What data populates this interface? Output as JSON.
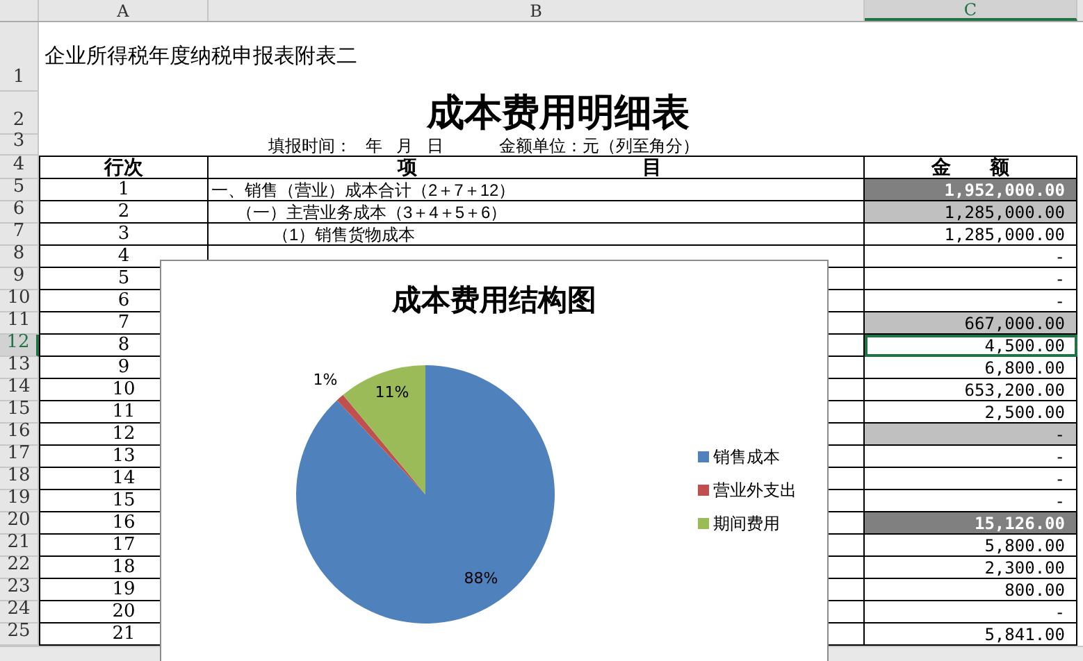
{
  "column_headers": [
    {
      "label": "A",
      "selected": false
    },
    {
      "label": "B",
      "selected": false
    },
    {
      "label": "C",
      "selected": true
    }
  ],
  "form_code": {
    "row_number": "1",
    "text": "企业所得税年度纳税申报表附表二"
  },
  "title": {
    "row_number": "2",
    "text": "成本费用明细表"
  },
  "meta": {
    "row_number": "3",
    "fill_date": "填报时间：   年   月   日",
    "unit": "金额单位：元（列至角分）"
  },
  "header": {
    "row_number": "4",
    "line": "行次",
    "item_left": "项",
    "item_right": "目",
    "amount": "金　　额"
  },
  "rows": [
    {
      "row_number": "5",
      "line": "1",
      "item": "一、销售（营业）成本合计（2＋7＋12）",
      "kind": "section",
      "amount": "1,952,000.00",
      "color": "#808080",
      "selected": false
    },
    {
      "row_number": "6",
      "line": "2",
      "item": "（一）主营业务成本（3＋4＋5＋6）",
      "kind": "group",
      "amount": "1,285,000.00",
      "color": "#c0c0c0",
      "selected": false
    },
    {
      "row_number": "7",
      "line": "3",
      "item": "（1）销售货物成本",
      "kind": "detail",
      "amount": "1,285,000.00",
      "selected": false
    },
    {
      "row_number": "8",
      "line": "4",
      "amount": "-",
      "selected": false
    },
    {
      "row_number": "9",
      "line": "5",
      "amount": "-",
      "selected": false
    },
    {
      "row_number": "10",
      "line": "6",
      "amount": "-",
      "selected": false
    },
    {
      "row_number": "11",
      "line": "7",
      "amount": "667,000.00",
      "color": "#c0c0c0",
      "selected": false
    },
    {
      "row_number": "12",
      "line": "8",
      "amount": "4,500.00",
      "selected": true
    },
    {
      "row_number": "13",
      "line": "9",
      "amount": "6,800.00",
      "selected": false
    },
    {
      "row_number": "14",
      "line": "10",
      "amount": "653,200.00",
      "selected": false
    },
    {
      "row_number": "15",
      "line": "11",
      "amount": "2,500.00",
      "selected": false
    },
    {
      "row_number": "16",
      "line": "12",
      "amount": "-",
      "color": "#c0c0c0",
      "selected": false
    },
    {
      "row_number": "17",
      "line": "13",
      "amount": "-",
      "selected": false
    },
    {
      "row_number": "18",
      "line": "14",
      "amount": "-",
      "selected": false
    },
    {
      "row_number": "19",
      "line": "15",
      "amount": "-",
      "selected": false
    },
    {
      "row_number": "20",
      "line": "16",
      "amount": "15,126.00",
      "color": "#808080",
      "selected": false
    },
    {
      "row_number": "21",
      "line": "17",
      "amount": "5,800.00",
      "selected": false
    },
    {
      "row_number": "22",
      "line": "18",
      "amount": "2,300.00",
      "selected": false
    },
    {
      "row_number": "23",
      "line": "19",
      "amount": "800.00",
      "selected": false
    },
    {
      "row_number": "24",
      "line": "20",
      "amount": "-",
      "selected": false
    },
    {
      "row_number": "25",
      "line": "21",
      "amount": "5,841.00",
      "selected": false
    }
  ],
  "chart_data": {
    "type": "pie",
    "title": "成本费用结构图",
    "categories": [
      "销售成本",
      "营业外支出",
      "期间费用"
    ],
    "values": [
      88,
      1,
      11
    ],
    "colors": [
      "#4f81bd",
      "#c0504d",
      "#9bbb59"
    ],
    "value_labels": [
      "88%",
      "1%",
      "11%"
    ],
    "legend": true
  }
}
